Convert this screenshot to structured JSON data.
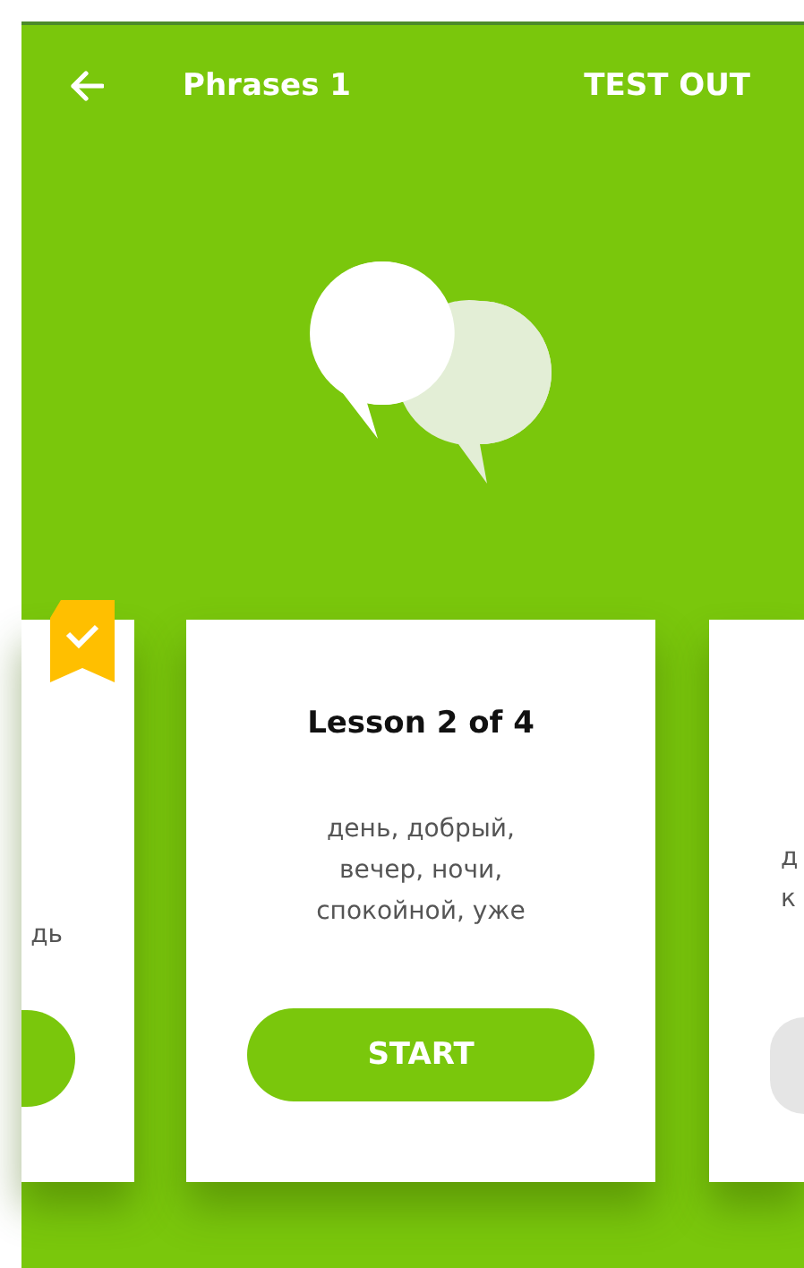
{
  "header": {
    "title": "Phrases 1",
    "action": "TEST OUT"
  },
  "lessons": [
    {
      "kind": "left",
      "completed": true,
      "locked": false,
      "description_lines": [
        "дь"
      ]
    },
    {
      "kind": "center",
      "completed": false,
      "locked": false,
      "title": "Lesson 2 of 4",
      "description_lines": [
        "день, добрый,",
        "вечер, ночи,",
        "спокойной, уже"
      ],
      "button": "START"
    },
    {
      "kind": "right",
      "completed": false,
      "locked": true,
      "description_lines": [
        "д",
        "к"
      ]
    }
  ]
}
